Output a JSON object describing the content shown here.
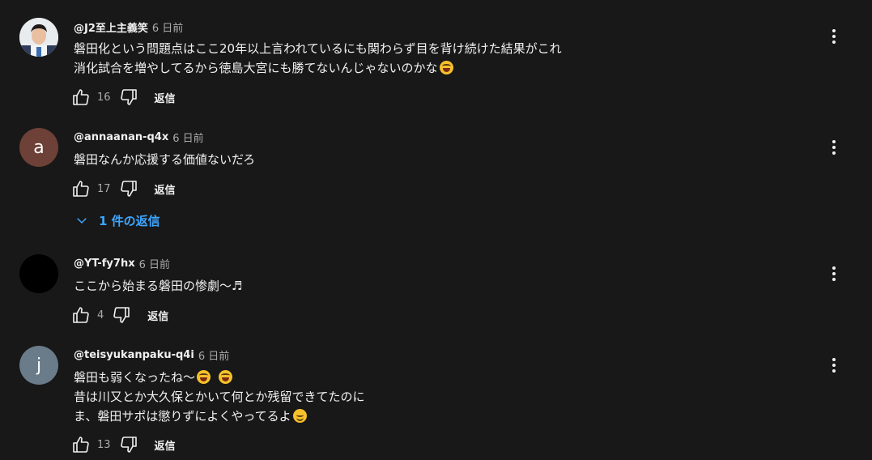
{
  "comments": [
    {
      "author": "@J2至上主義笑",
      "time": "6 日前",
      "lines": [
        "磐田化という問題点はここ20年以上言われているにも関わらず目を背け続けた結果がこれ",
        "消化試合を増やしてるから徳島大宮にも勝てないんじゃないのかな"
      ],
      "likes": "16",
      "reply_label": "返信",
      "avatar_kind": "photo"
    },
    {
      "author": "@annaanan-q4x",
      "time": "6 日前",
      "lines": [
        "磐田なんか応援する価値ないだろ"
      ],
      "likes": "17",
      "reply_label": "返信",
      "avatar_letter": "a",
      "avatar_color": "#6d4137",
      "replies_toggle": "1 件の返信"
    },
    {
      "author": "@YT-fy7hx",
      "time": "6 日前",
      "lines": [
        "ここから始まる磐田の惨劇〜♬"
      ],
      "likes": "4",
      "reply_label": "返信",
      "avatar_color": "#000000"
    },
    {
      "author": "@teisyukanpaku-q4i",
      "time": "6 日前",
      "lines": [
        "磐田も弱くなったね〜",
        "昔は川又とか大久保とかいて何とか残留できてたのに",
        "ま、磐田サポは懲りずによくやってるよ"
      ],
      "likes": "13",
      "reply_label": "返信",
      "avatar_letter": "j",
      "avatar_color": "#6a7b8a"
    }
  ],
  "icons": {
    "like": "thumbs-up-icon",
    "dislike": "thumbs-down-icon",
    "menu": "more-vert-icon",
    "expand": "chevron-down-icon",
    "emoji_laugh": "face-with-tears-of-joy",
    "emoji_smile": "smiling-face"
  },
  "colors": {
    "background": "#181818",
    "text": "#f1f1f1",
    "secondary": "#aaaaaa",
    "link": "#3ea6ff"
  }
}
